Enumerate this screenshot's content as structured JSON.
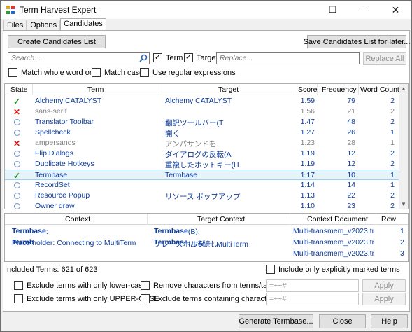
{
  "window": {
    "title": "Term Harvest Expert",
    "minimize": "—",
    "maximize": "☐",
    "close": "✕"
  },
  "tabs": [
    {
      "label": "Files"
    },
    {
      "label": "Options"
    },
    {
      "label": "Candidates"
    }
  ],
  "toolbar": {
    "create_label": "Create Candidates List",
    "save_label": "Save Candidates List for later...",
    "search_placeholder": "Search...",
    "term_label": "Term",
    "target_label": "Target",
    "replace_placeholder": "Replace...",
    "replace_all_label": "Replace All",
    "match_whole_word": "Match whole word only",
    "match_case": "Match case",
    "use_regex": "Use regular expressions"
  },
  "terms_table": {
    "headers": [
      "State",
      "Term",
      "Target",
      "Score",
      "Frequency",
      "Word Count"
    ],
    "rows": [
      {
        "state": "accepted",
        "term": "Alchemy CATALYST",
        "target": "Alchemy CATALYST",
        "score": "1.59",
        "freq": "79",
        "wc": "2",
        "dim": false
      },
      {
        "state": "rejected",
        "term": "sans-serif",
        "target": "",
        "score": "1.56",
        "freq": "21",
        "wc": "2",
        "dim": true
      },
      {
        "state": "open",
        "term": "Translator Toolbar",
        "target": "翻訳ツールバー(T",
        "score": "1.47",
        "freq": "48",
        "wc": "2",
        "dim": false
      },
      {
        "state": "open",
        "term": "Spellcheck",
        "target": "開く",
        "score": "1.27",
        "freq": "26",
        "wc": "1",
        "dim": false
      },
      {
        "state": "rejected",
        "term": "ampersands",
        "target": "アンパサンドを",
        "score": "1.23",
        "freq": "28",
        "wc": "1",
        "dim": true
      },
      {
        "state": "open",
        "term": "Flip Dialogs",
        "target": "ダイアログの反転(A",
        "score": "1.19",
        "freq": "12",
        "wc": "2",
        "dim": false
      },
      {
        "state": "open",
        "term": "Duplicate Hotkeys",
        "target": "重複したホットキー(H",
        "score": "1.19",
        "freq": "12",
        "wc": "2",
        "dim": false
      },
      {
        "state": "accepted",
        "term": "Termbase",
        "target": "Termbase",
        "score": "1.17",
        "freq": "10",
        "wc": "1",
        "dim": false,
        "selected": true
      },
      {
        "state": "open",
        "term": "RecordSet",
        "target": "",
        "score": "1.14",
        "freq": "14",
        "wc": "1",
        "dim": false
      },
      {
        "state": "open",
        "term": "Resource Popup",
        "target": "リソース ポップアップ",
        "score": "1.13",
        "freq": "22",
        "wc": "2",
        "dim": false
      },
      {
        "state": "open",
        "term": "Owner draw",
        "target": "",
        "score": "1.10",
        "freq": "23",
        "wc": "2",
        "dim": false
      }
    ]
  },
  "context_table": {
    "headers": [
      "Context",
      "Target Context",
      "Context Document",
      "Row"
    ],
    "rows": [
      {
        "ctx_bold": "Termbase",
        "ctx_rest": ":",
        "tctx_bold": "Termbase",
        "tctx_rest": "(B):",
        "doc": "Multi-transmem_v2023.tm -",
        "row": "1"
      },
      {
        "ctx_pre": "Place holder:  Connecting to MultiTerm ",
        "ctx_bold": "Termb",
        "tctx_pre": "プレースホルダー: MultiTerm ",
        "tctx_bold": "Termbase",
        "tctx_rest": " に接続し",
        "doc": "Multi-transmem_v2023.tm -",
        "row": "2"
      },
      {
        "ctx_pre": "Please wait while Catalyst connects to the sp",
        "tctx_pre": "利用可能な言語を確認するために指定した Multi",
        "doc": "Multi-transmem_v2023.tm -",
        "row": "3"
      }
    ]
  },
  "summary": {
    "included_terms": "Included Terms: 621 of 623",
    "only_marked": "Include only explicitly marked terms"
  },
  "filters": {
    "lower_case": "Exclude terms with only lower-case",
    "upper_case": "Exclude terms with only UPPER-CASE",
    "remove_chars": "Remove characters from terms/targets:",
    "remove_chars_value": "=+~#",
    "exclude_chars": "Exclude terms containing characters:",
    "exclude_chars_value": "=+~#",
    "apply": "Apply"
  },
  "footer": {
    "generate": "Generate Termbase...",
    "close": "Close",
    "help": "Help"
  },
  "colors": {
    "accent": "#0b3a9c",
    "accepted": "#1a8f1a",
    "rejected": "#e01b1b",
    "open": "#6e8fc7",
    "selected_bg": "#e5f3fb"
  }
}
